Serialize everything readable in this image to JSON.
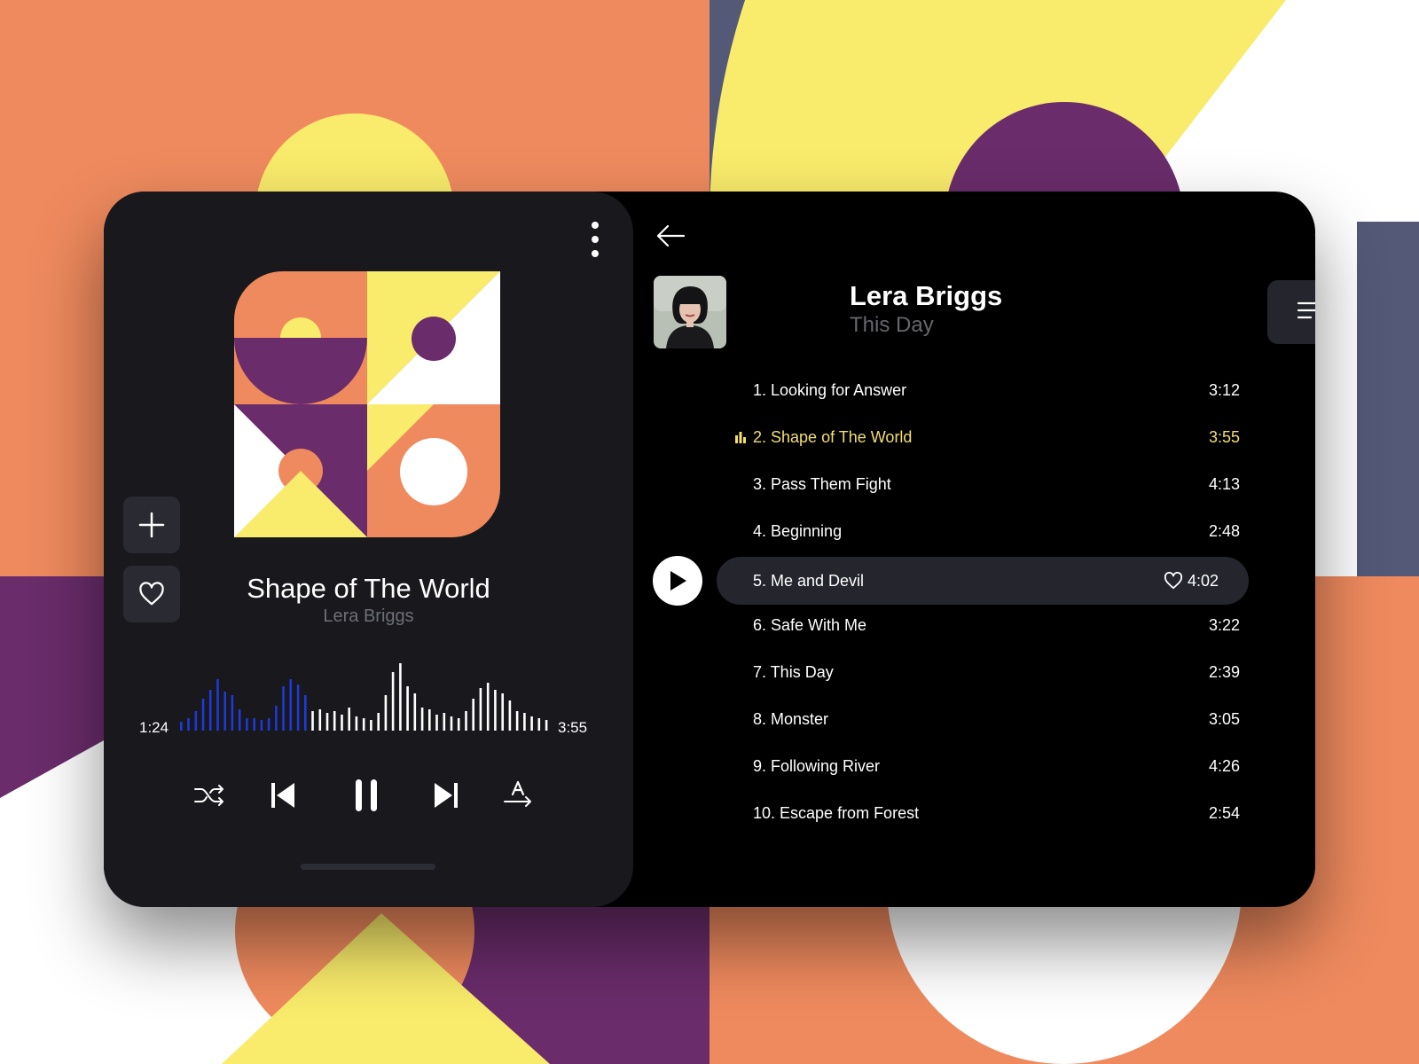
{
  "colors": {
    "orange": "#ef8a5e",
    "yellow": "#f9eb6b",
    "purple": "#6a2c6b",
    "slate": "#545978",
    "panel": "#18181d",
    "card": "#000000",
    "accent_wave": "#1f3ad6",
    "active_track": "#f3df6e",
    "muted_text": "#6e6e78"
  },
  "player": {
    "title": "Shape of The World",
    "artist": "Lera Briggs",
    "elapsed": "1:24",
    "duration": "3:55",
    "progress_fraction": 0.357,
    "icons": {
      "menu": "more-vertical-icon",
      "add": "plus-icon",
      "favorite": "heart-icon",
      "shuffle": "shuffle-icon",
      "previous": "skip-previous-icon",
      "pause": "pause-icon",
      "next": "skip-next-icon",
      "text_direction": "text-direction-icon"
    }
  },
  "album": {
    "artist": "Lera Briggs",
    "name": "This Day",
    "icons": {
      "back": "arrow-left-icon",
      "search": "search-icon",
      "queue": "playlist-music-icon",
      "playing": "equalizer-icon",
      "play": "play-icon",
      "row_favorite": "heart-icon"
    }
  },
  "tracks": [
    {
      "label": "1. Looking for Answer",
      "duration": "3:12"
    },
    {
      "label": "2. Shape of The World",
      "duration": "3:55"
    },
    {
      "label": "3. Pass Them Fight",
      "duration": "4:13"
    },
    {
      "label": "4. Beginning",
      "duration": "2:48"
    },
    {
      "label": "5. Me and Devil",
      "duration": "4:02"
    },
    {
      "label": "6. Safe With Me",
      "duration": "3:22"
    },
    {
      "label": "7. This Day",
      "duration": "2:39"
    },
    {
      "label": "8. Monster",
      "duration": "3:05"
    },
    {
      "label": "9. Following River",
      "duration": "4:26"
    },
    {
      "label": "10. Escape from Forest",
      "duration": "2:54"
    }
  ]
}
